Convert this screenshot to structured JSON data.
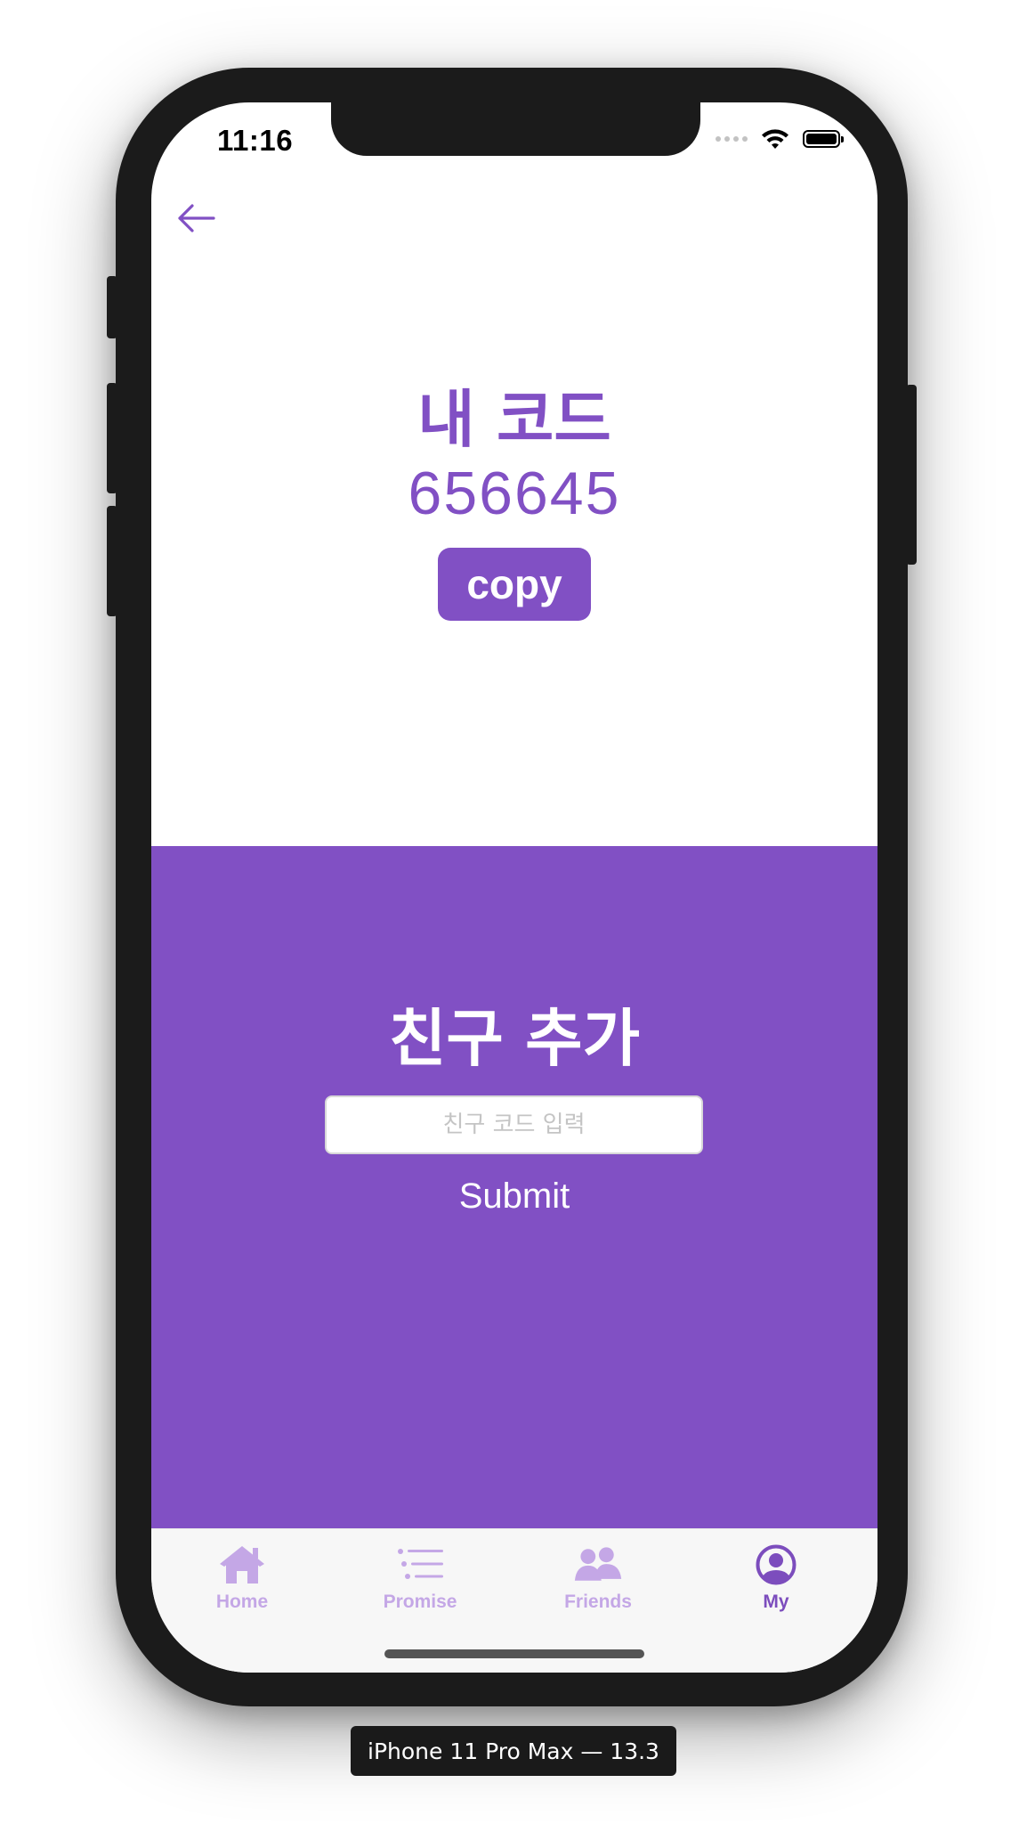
{
  "status_bar": {
    "time": "11:16"
  },
  "my_code": {
    "title": "내 코드",
    "code": "656645",
    "copy_label": "copy"
  },
  "add_friend": {
    "title": "친구 추가",
    "input_placeholder": "친구 코드 입력",
    "input_value": "",
    "submit_label": "Submit"
  },
  "tab_bar": {
    "items": [
      {
        "label": "Home",
        "icon": "home-icon",
        "active": false
      },
      {
        "label": "Promise",
        "icon": "list-icon",
        "active": false
      },
      {
        "label": "Friends",
        "icon": "people-icon",
        "active": false
      },
      {
        "label": "My",
        "icon": "user-circle-icon",
        "active": true
      }
    ]
  },
  "device_label": "iPhone 11 Pro Max — 13.3",
  "colors": {
    "accent": "#8150c4",
    "tab_inactive": "#c4a7e6",
    "tab_active": "#7c4dbd"
  }
}
